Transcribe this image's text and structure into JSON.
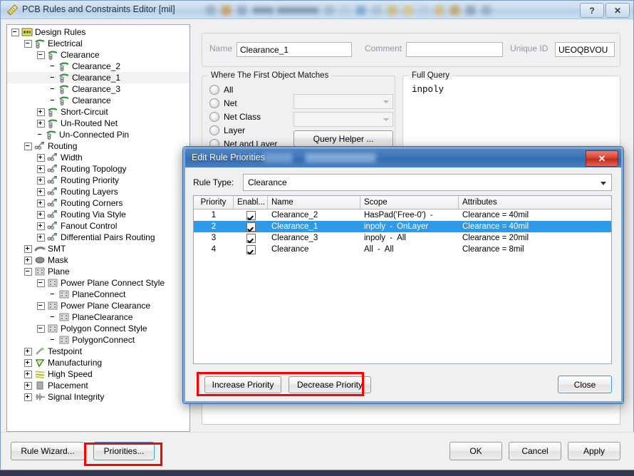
{
  "window": {
    "title": "PCB Rules and Constraints Editor [mil]",
    "icon": "ruler-pencil-icon",
    "help_button": "?",
    "close_button": "✕"
  },
  "tree": {
    "items": [
      {
        "label": "Design Rules",
        "depth": 0,
        "toggle": "minus",
        "icon": "design-rules-icon",
        "selected": false
      },
      {
        "label": "Electrical",
        "depth": 1,
        "toggle": "minus",
        "icon": "electrical-icon",
        "selected": false
      },
      {
        "label": "Clearance",
        "depth": 2,
        "toggle": "minus",
        "icon": "electrical-icon",
        "selected": false
      },
      {
        "label": "Clearance_2",
        "depth": 3,
        "toggle": "none",
        "icon": "electrical-icon",
        "selected": false
      },
      {
        "label": "Clearance_1",
        "depth": 3,
        "toggle": "none",
        "icon": "electrical-icon",
        "selected": true
      },
      {
        "label": "Clearance_3",
        "depth": 3,
        "toggle": "none",
        "icon": "electrical-icon",
        "selected": false
      },
      {
        "label": "Clearance",
        "depth": 3,
        "toggle": "none",
        "icon": "electrical-icon",
        "selected": false
      },
      {
        "label": "Short-Circuit",
        "depth": 2,
        "toggle": "plus",
        "icon": "electrical-icon",
        "selected": false
      },
      {
        "label": "Un-Routed Net",
        "depth": 2,
        "toggle": "plus",
        "icon": "electrical-icon",
        "selected": false
      },
      {
        "label": "Un-Connected Pin",
        "depth": 2,
        "toggle": "none",
        "icon": "electrical-icon",
        "selected": false
      },
      {
        "label": "Routing",
        "depth": 1,
        "toggle": "minus",
        "icon": "routing-icon",
        "selected": false
      },
      {
        "label": "Width",
        "depth": 2,
        "toggle": "plus",
        "icon": "routing-icon",
        "selected": false
      },
      {
        "label": "Routing Topology",
        "depth": 2,
        "toggle": "plus",
        "icon": "routing-icon",
        "selected": false
      },
      {
        "label": "Routing Priority",
        "depth": 2,
        "toggle": "plus",
        "icon": "routing-icon",
        "selected": false
      },
      {
        "label": "Routing Layers",
        "depth": 2,
        "toggle": "plus",
        "icon": "routing-icon",
        "selected": false
      },
      {
        "label": "Routing Corners",
        "depth": 2,
        "toggle": "plus",
        "icon": "routing-icon",
        "selected": false
      },
      {
        "label": "Routing Via Style",
        "depth": 2,
        "toggle": "plus",
        "icon": "routing-icon",
        "selected": false
      },
      {
        "label": "Fanout Control",
        "depth": 2,
        "toggle": "plus",
        "icon": "routing-icon",
        "selected": false
      },
      {
        "label": "Differential Pairs Routing",
        "depth": 2,
        "toggle": "plus",
        "icon": "routing-icon",
        "selected": false
      },
      {
        "label": "SMT",
        "depth": 1,
        "toggle": "plus",
        "icon": "smt-icon",
        "selected": false
      },
      {
        "label": "Mask",
        "depth": 1,
        "toggle": "plus",
        "icon": "mask-icon",
        "selected": false
      },
      {
        "label": "Plane",
        "depth": 1,
        "toggle": "minus",
        "icon": "plane-icon",
        "selected": false
      },
      {
        "label": "Power Plane Connect Style",
        "depth": 2,
        "toggle": "minus",
        "icon": "plane-icon",
        "selected": false
      },
      {
        "label": "PlaneConnect",
        "depth": 3,
        "toggle": "none",
        "icon": "plane-icon",
        "selected": false
      },
      {
        "label": "Power Plane Clearance",
        "depth": 2,
        "toggle": "minus",
        "icon": "plane-icon",
        "selected": false
      },
      {
        "label": "PlaneClearance",
        "depth": 3,
        "toggle": "none",
        "icon": "plane-icon",
        "selected": false
      },
      {
        "label": "Polygon Connect Style",
        "depth": 2,
        "toggle": "minus",
        "icon": "plane-icon",
        "selected": false
      },
      {
        "label": "PolygonConnect",
        "depth": 3,
        "toggle": "none",
        "icon": "plane-icon",
        "selected": false
      },
      {
        "label": "Testpoint",
        "depth": 1,
        "toggle": "plus",
        "icon": "testpoint-icon",
        "selected": false
      },
      {
        "label": "Manufacturing",
        "depth": 1,
        "toggle": "plus",
        "icon": "manufacturing-icon",
        "selected": false
      },
      {
        "label": "High Speed",
        "depth": 1,
        "toggle": "plus",
        "icon": "high-speed-icon",
        "selected": false
      },
      {
        "label": "Placement",
        "depth": 1,
        "toggle": "plus",
        "icon": "placement-icon",
        "selected": false
      },
      {
        "label": "Signal Integrity",
        "depth": 1,
        "toggle": "plus",
        "icon": "signal-integrity-icon",
        "selected": false
      }
    ]
  },
  "rule_form": {
    "name_label": "Name",
    "name_value": "Clearance_1",
    "comment_label": "Comment",
    "comment_value": "",
    "unique_id_label": "Unique ID",
    "unique_id_value": "UEOQBVOU",
    "match_group_title": "Where The First Object Matches",
    "match_options": [
      {
        "label": "All",
        "checked": false
      },
      {
        "label": "Net",
        "checked": false
      },
      {
        "label": "Net Class",
        "checked": false
      },
      {
        "label": "Layer",
        "checked": false
      },
      {
        "label": "Net and Layer",
        "checked": false
      }
    ],
    "net_combo_value": "",
    "net_class_combo_value": "",
    "query_helper_label": "Query Helper ...",
    "full_query_title": "Full Query",
    "full_query_value": "inpoly"
  },
  "bottom_bar": {
    "rule_wizard": "Rule Wizard...",
    "priorities": "Priorities...",
    "ok": "OK",
    "cancel": "Cancel",
    "apply": "Apply"
  },
  "dialog": {
    "title": "Edit Rule Priorities",
    "close_button": "✕",
    "rule_type_label": "Rule Type:",
    "rule_type_value": "Clearance",
    "columns": [
      "Priority",
      "Enabl...",
      "Name",
      "Scope",
      "Attributes"
    ],
    "rows": [
      {
        "priority": "1",
        "enabled": true,
        "name": "Clearance_2",
        "scope_a": "HasPad('Free-0')",
        "scope_dash": "-",
        "scope_b": "",
        "attributes": "Clearance = 40mil",
        "selected": false
      },
      {
        "priority": "2",
        "enabled": true,
        "name": "Clearance_1",
        "scope_a": "inpoly",
        "scope_dash": "-",
        "scope_b": "OnLayer",
        "attributes": "Clearance = 40mil",
        "selected": true
      },
      {
        "priority": "3",
        "enabled": true,
        "name": "Clearance_3",
        "scope_a": "inpoly",
        "scope_dash": "-",
        "scope_b": "All",
        "attributes": "Clearance = 20mil",
        "selected": false
      },
      {
        "priority": "4",
        "enabled": true,
        "name": "Clearance",
        "scope_a": "All",
        "scope_dash": "-",
        "scope_b": "All",
        "attributes": "Clearance = 8mil",
        "selected": false
      }
    ],
    "increase_priority": "Increase Priority",
    "decrease_priority": "Decrease Priority",
    "close_label": "Close"
  },
  "annotations": {
    "highlight_color": "#ff0000",
    "focus_color": "#3c9fd6",
    "selection_color": "#2f9ae8"
  }
}
